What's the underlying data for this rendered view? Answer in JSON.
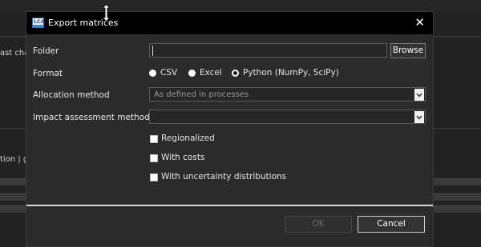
{
  "background": {
    "text_row1": "ast cha",
    "text_row2": "tion | g"
  },
  "dialog": {
    "title": "Export matrices",
    "app_icon_text": "LCA",
    "close_symbol": "✕",
    "folder": {
      "label": "Folder",
      "value": "",
      "browse_label": "Browse"
    },
    "format": {
      "label": "Format",
      "options": [
        "CSV",
        "Excel",
        "Python (NumPy, SciPy)"
      ],
      "selected": "Python (NumPy, SciPy)"
    },
    "allocation": {
      "label": "Allocation method",
      "selected": "As defined in processes"
    },
    "impact": {
      "label": "Impact assessment method",
      "selected": ""
    },
    "checkboxes": {
      "regionalized": {
        "label": "Regionalized",
        "checked": false
      },
      "with_costs": {
        "label": "With costs",
        "checked": false
      },
      "with_uncertainty": {
        "label": "With uncertainty distributions",
        "checked": false
      }
    },
    "buttons": {
      "ok": "OK",
      "cancel": "Cancel"
    }
  },
  "icons": {
    "close": "close-icon",
    "dropdown": "chevron-down-icon",
    "cursor": "resize-vertical-cursor-icon",
    "app": "lca-app-icon"
  },
  "colors": {
    "dialog_bg": "#2b2b2b",
    "titlebar_bg": "#000000",
    "text": "#e6e6e6"
  }
}
